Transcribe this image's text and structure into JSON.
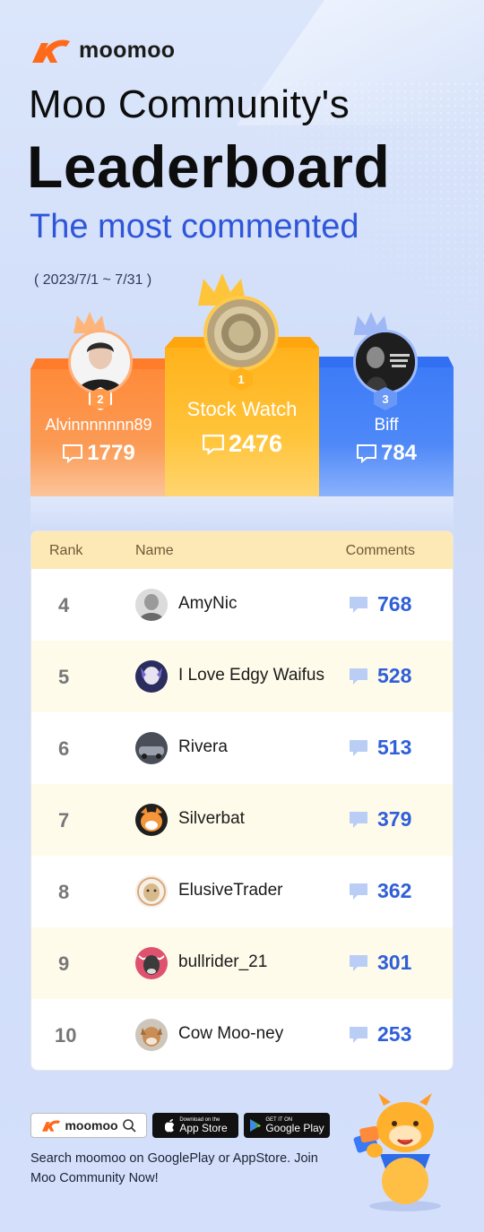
{
  "brand": {
    "name": "moomoo"
  },
  "header": {
    "title_line1": "Moo Community's",
    "title_line2": "Leaderboard",
    "subtitle": "The most commented",
    "date_range": "( 2023/7/1 ~ 7/31 )"
  },
  "podium": [
    {
      "rank": "2",
      "name": "Alvinnnnnnn89",
      "comments": "1779"
    },
    {
      "rank": "1",
      "name": "Stock Watch",
      "comments": "2476"
    },
    {
      "rank": "3",
      "name": "Biff",
      "comments": "784"
    }
  ],
  "table": {
    "headers": {
      "rank": "Rank",
      "name": "Name",
      "comments": "Comments"
    },
    "rows": [
      {
        "rank": "4",
        "name": "AmyNic",
        "comments": "768"
      },
      {
        "rank": "5",
        "name": "I Love Edgy Waifus",
        "comments": "528"
      },
      {
        "rank": "6",
        "name": "Rivera",
        "comments": "513"
      },
      {
        "rank": "7",
        "name": "Silverbat",
        "comments": "379"
      },
      {
        "rank": "8",
        "name": "ElusiveTrader",
        "comments": "362"
      },
      {
        "rank": "9",
        "name": "bullrider_21",
        "comments": "301"
      },
      {
        "rank": "10",
        "name": "Cow Moo-ney",
        "comments": "253"
      }
    ]
  },
  "footer": {
    "search_badge": "moomoo",
    "app_store_small": "Download on the",
    "app_store": "App Store",
    "google_play_small": "GET IT ON",
    "google_play": "Google Play",
    "text": "Search moomoo on GooglePlay or AppStore. Join Moo Community Now!"
  },
  "colors": {
    "accent": "#2f5fd8",
    "orange": "#ff8a3a",
    "gold": "#ffb21c",
    "blue": "#3d7bf7"
  }
}
